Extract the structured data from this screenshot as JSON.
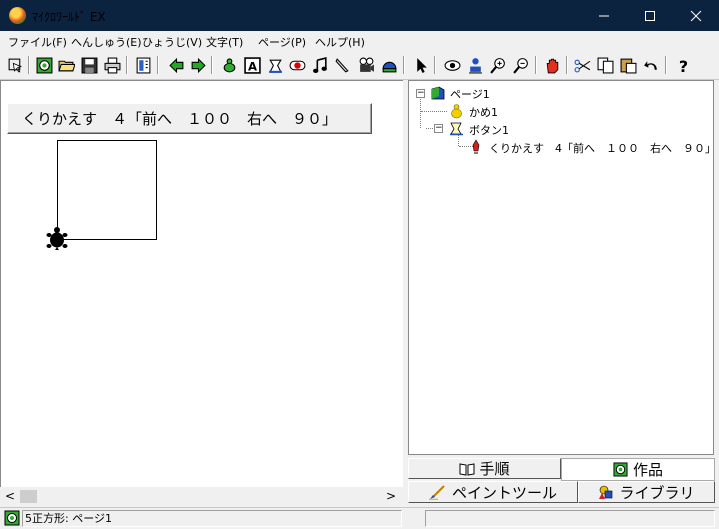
{
  "window": {
    "title": "ﾏｲｸﾛﾜｰﾙﾄﾞ EX",
    "minimize": "—",
    "maximize": "☐",
    "close": "✕"
  },
  "menu": [
    "ファイル(F)",
    "へんしゅう(E)",
    "ひょうじ(V)",
    "文字(T)",
    "ページ(P)",
    "ヘルプ(H)"
  ],
  "toolbar": [
    "pointer",
    "new",
    "open",
    "save",
    "print",
    "layout",
    "prev",
    "next",
    "turtle",
    "text",
    "stamp",
    "button",
    "music",
    "pen",
    "projector",
    "library",
    "select",
    "eye",
    "stamp2",
    "zoom-in",
    "zoom-out",
    "stop",
    "cut",
    "copy",
    "paste",
    "undo",
    "help"
  ],
  "canvas": {
    "button_label": "くりかえす　４「前へ　１００　右へ　９０」"
  },
  "tree": {
    "page": "ページ1",
    "turtle": "かめ1",
    "button": "ボタン1",
    "command": "くりかえす　4「前へ　１００　右へ　９０」"
  },
  "tabs": {
    "procedure": "手順",
    "works": "作品",
    "paint": "ペイントツール",
    "library": "ライブラリ"
  },
  "status": {
    "text": "5正方形: ページ1",
    "right": ""
  },
  "scroll": {
    "left_arrow": "<",
    "right_arrow": ">"
  }
}
